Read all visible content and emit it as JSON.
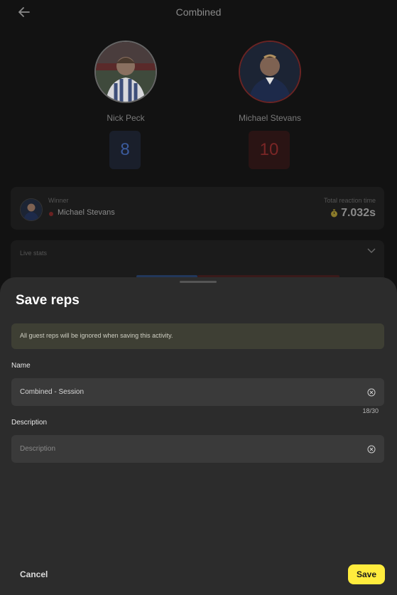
{
  "header": {
    "title": "Combined",
    "back_icon": "arrow-left-icon"
  },
  "players": [
    {
      "name": "Nick Peck",
      "score": "8",
      "color": "#3b5b9c"
    },
    {
      "name": "Michael Stevans",
      "score": "10",
      "color": "#7a2626"
    }
  ],
  "winner": {
    "label": "Winner",
    "name": "Michael Stevans",
    "time_label": "Total reaction time",
    "time_value": "7.032s",
    "time_icon": "stopwatch-icon"
  },
  "live_stats": {
    "label": "Live stats",
    "chevron_icon": "chevron-down-icon"
  },
  "sheet": {
    "title": "Save reps",
    "notice": "All guest reps will be ignored when saving this activity.",
    "name_label": "Name",
    "name_value": "Combined - Session",
    "name_counter": "18/30",
    "description_label": "Description",
    "description_placeholder": "Description",
    "clear_icon": "clear-circle-icon",
    "cancel_label": "Cancel",
    "save_label": "Save"
  },
  "colors": {
    "accent": "#ffec3d",
    "sheet_bg": "#2c2c2c",
    "notice_bg": "#3e3f34"
  }
}
